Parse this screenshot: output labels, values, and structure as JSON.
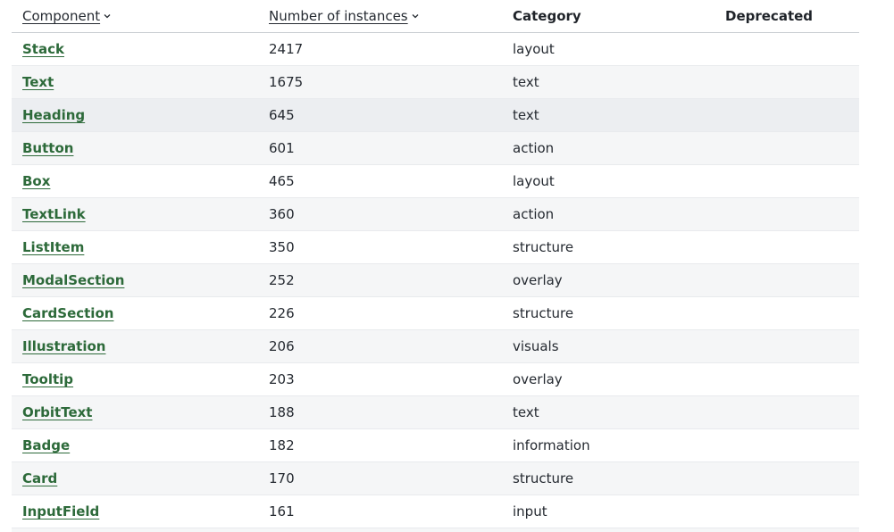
{
  "table": {
    "headers": {
      "component": "Component",
      "instances": "Number of instances",
      "category": "Category",
      "deprecated": "Deprecated"
    },
    "rows": [
      {
        "component": "Stack",
        "instances": "2417",
        "category": "layout",
        "deprecated": ""
      },
      {
        "component": "Text",
        "instances": "1675",
        "category": "text",
        "deprecated": ""
      },
      {
        "component": "Heading",
        "instances": "645",
        "category": "text",
        "deprecated": ""
      },
      {
        "component": "Button",
        "instances": "601",
        "category": "action",
        "deprecated": ""
      },
      {
        "component": "Box",
        "instances": "465",
        "category": "layout",
        "deprecated": ""
      },
      {
        "component": "TextLink",
        "instances": "360",
        "category": "action",
        "deprecated": ""
      },
      {
        "component": "ListItem",
        "instances": "350",
        "category": "structure",
        "deprecated": ""
      },
      {
        "component": "ModalSection",
        "instances": "252",
        "category": "overlay",
        "deprecated": ""
      },
      {
        "component": "CardSection",
        "instances": "226",
        "category": "structure",
        "deprecated": ""
      },
      {
        "component": "Illustration",
        "instances": "206",
        "category": "visuals",
        "deprecated": ""
      },
      {
        "component": "Tooltip",
        "instances": "203",
        "category": "overlay",
        "deprecated": ""
      },
      {
        "component": "OrbitText",
        "instances": "188",
        "category": "text",
        "deprecated": ""
      },
      {
        "component": "Badge",
        "instances": "182",
        "category": "information",
        "deprecated": ""
      },
      {
        "component": "Card",
        "instances": "170",
        "category": "structure",
        "deprecated": ""
      },
      {
        "component": "InputField",
        "instances": "161",
        "category": "input",
        "deprecated": ""
      }
    ]
  },
  "colors": {
    "link": "#2d6a3a",
    "row_alt": "#f5f6f7",
    "row_hover": "#eceef1",
    "text": "#252a31"
  },
  "icons": {
    "sort": "chevron-down-icon"
  }
}
